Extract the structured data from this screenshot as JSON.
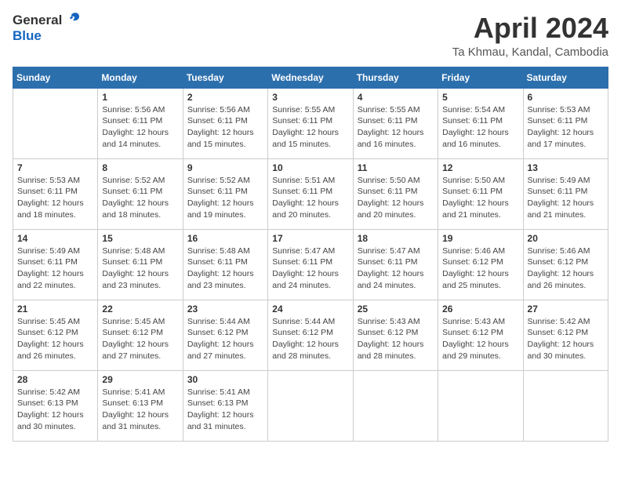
{
  "header": {
    "logo_general": "General",
    "logo_blue": "Blue",
    "month_title": "April 2024",
    "location": "Ta Khmau, Kandal, Cambodia"
  },
  "days_of_week": [
    "Sunday",
    "Monday",
    "Tuesday",
    "Wednesday",
    "Thursday",
    "Friday",
    "Saturday"
  ],
  "weeks": [
    [
      {
        "day": "",
        "info": ""
      },
      {
        "day": "1",
        "info": "Sunrise: 5:56 AM\nSunset: 6:11 PM\nDaylight: 12 hours\nand 14 minutes."
      },
      {
        "day": "2",
        "info": "Sunrise: 5:56 AM\nSunset: 6:11 PM\nDaylight: 12 hours\nand 15 minutes."
      },
      {
        "day": "3",
        "info": "Sunrise: 5:55 AM\nSunset: 6:11 PM\nDaylight: 12 hours\nand 15 minutes."
      },
      {
        "day": "4",
        "info": "Sunrise: 5:55 AM\nSunset: 6:11 PM\nDaylight: 12 hours\nand 16 minutes."
      },
      {
        "day": "5",
        "info": "Sunrise: 5:54 AM\nSunset: 6:11 PM\nDaylight: 12 hours\nand 16 minutes."
      },
      {
        "day": "6",
        "info": "Sunrise: 5:53 AM\nSunset: 6:11 PM\nDaylight: 12 hours\nand 17 minutes."
      }
    ],
    [
      {
        "day": "7",
        "info": "Sunrise: 5:53 AM\nSunset: 6:11 PM\nDaylight: 12 hours\nand 18 minutes."
      },
      {
        "day": "8",
        "info": "Sunrise: 5:52 AM\nSunset: 6:11 PM\nDaylight: 12 hours\nand 18 minutes."
      },
      {
        "day": "9",
        "info": "Sunrise: 5:52 AM\nSunset: 6:11 PM\nDaylight: 12 hours\nand 19 minutes."
      },
      {
        "day": "10",
        "info": "Sunrise: 5:51 AM\nSunset: 6:11 PM\nDaylight: 12 hours\nand 20 minutes."
      },
      {
        "day": "11",
        "info": "Sunrise: 5:50 AM\nSunset: 6:11 PM\nDaylight: 12 hours\nand 20 minutes."
      },
      {
        "day": "12",
        "info": "Sunrise: 5:50 AM\nSunset: 6:11 PM\nDaylight: 12 hours\nand 21 minutes."
      },
      {
        "day": "13",
        "info": "Sunrise: 5:49 AM\nSunset: 6:11 PM\nDaylight: 12 hours\nand 21 minutes."
      }
    ],
    [
      {
        "day": "14",
        "info": "Sunrise: 5:49 AM\nSunset: 6:11 PM\nDaylight: 12 hours\nand 22 minutes."
      },
      {
        "day": "15",
        "info": "Sunrise: 5:48 AM\nSunset: 6:11 PM\nDaylight: 12 hours\nand 23 minutes."
      },
      {
        "day": "16",
        "info": "Sunrise: 5:48 AM\nSunset: 6:11 PM\nDaylight: 12 hours\nand 23 minutes."
      },
      {
        "day": "17",
        "info": "Sunrise: 5:47 AM\nSunset: 6:11 PM\nDaylight: 12 hours\nand 24 minutes."
      },
      {
        "day": "18",
        "info": "Sunrise: 5:47 AM\nSunset: 6:11 PM\nDaylight: 12 hours\nand 24 minutes."
      },
      {
        "day": "19",
        "info": "Sunrise: 5:46 AM\nSunset: 6:12 PM\nDaylight: 12 hours\nand 25 minutes."
      },
      {
        "day": "20",
        "info": "Sunrise: 5:46 AM\nSunset: 6:12 PM\nDaylight: 12 hours\nand 26 minutes."
      }
    ],
    [
      {
        "day": "21",
        "info": "Sunrise: 5:45 AM\nSunset: 6:12 PM\nDaylight: 12 hours\nand 26 minutes."
      },
      {
        "day": "22",
        "info": "Sunrise: 5:45 AM\nSunset: 6:12 PM\nDaylight: 12 hours\nand 27 minutes."
      },
      {
        "day": "23",
        "info": "Sunrise: 5:44 AM\nSunset: 6:12 PM\nDaylight: 12 hours\nand 27 minutes."
      },
      {
        "day": "24",
        "info": "Sunrise: 5:44 AM\nSunset: 6:12 PM\nDaylight: 12 hours\nand 28 minutes."
      },
      {
        "day": "25",
        "info": "Sunrise: 5:43 AM\nSunset: 6:12 PM\nDaylight: 12 hours\nand 28 minutes."
      },
      {
        "day": "26",
        "info": "Sunrise: 5:43 AM\nSunset: 6:12 PM\nDaylight: 12 hours\nand 29 minutes."
      },
      {
        "day": "27",
        "info": "Sunrise: 5:42 AM\nSunset: 6:12 PM\nDaylight: 12 hours\nand 30 minutes."
      }
    ],
    [
      {
        "day": "28",
        "info": "Sunrise: 5:42 AM\nSunset: 6:13 PM\nDaylight: 12 hours\nand 30 minutes."
      },
      {
        "day": "29",
        "info": "Sunrise: 5:41 AM\nSunset: 6:13 PM\nDaylight: 12 hours\nand 31 minutes."
      },
      {
        "day": "30",
        "info": "Sunrise: 5:41 AM\nSunset: 6:13 PM\nDaylight: 12 hours\nand 31 minutes."
      },
      {
        "day": "",
        "info": ""
      },
      {
        "day": "",
        "info": ""
      },
      {
        "day": "",
        "info": ""
      },
      {
        "day": "",
        "info": ""
      }
    ]
  ]
}
